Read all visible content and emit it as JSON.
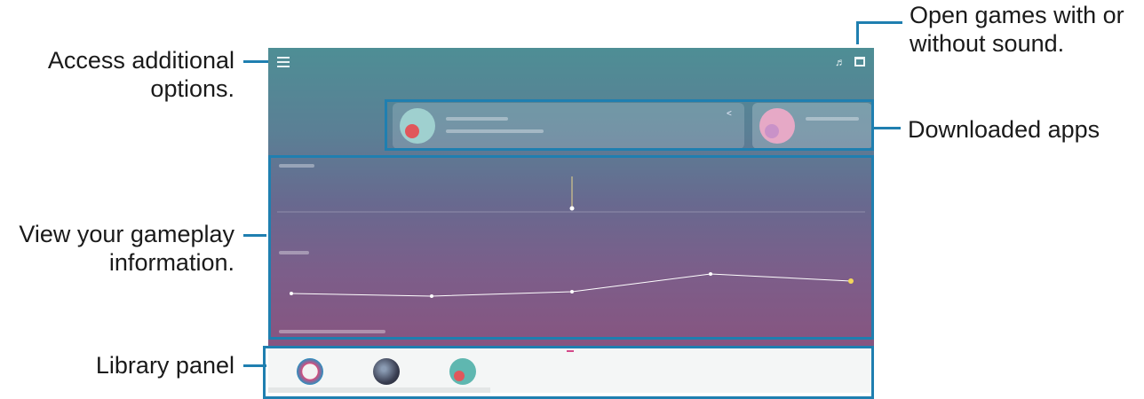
{
  "callouts": {
    "additional_options": "Access additional\noptions.",
    "sound": "Open games with or\nwithout sound.",
    "downloaded_apps": "Downloaded apps",
    "gameplay_info": "View your gameplay\ninformation.",
    "library_panel": "Library panel"
  },
  "colors": {
    "callout_line": "#1f7fb0",
    "screen_top": "#4e8e95",
    "screen_bottom": "#8e4f7a"
  },
  "screen": {
    "icons": [
      "menu-icon",
      "sound-icon",
      "screen-mode-icon",
      "share-icon"
    ]
  }
}
